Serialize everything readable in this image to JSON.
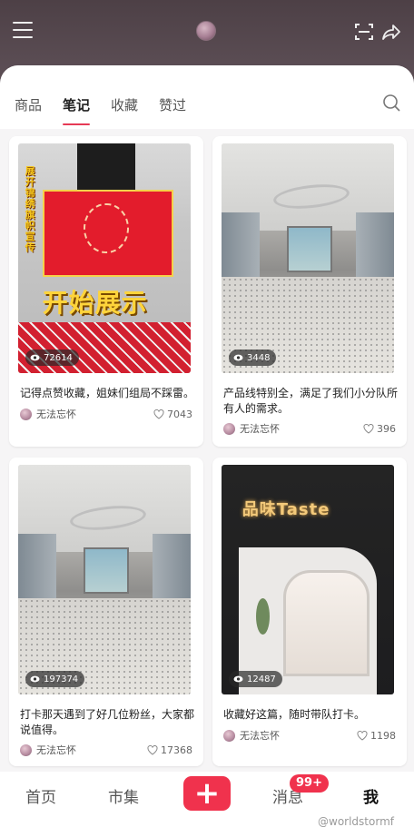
{
  "header": {
    "menu_icon": "menu-icon",
    "scan_icon": "scan-icon",
    "share_icon": "share-icon"
  },
  "tabs": [
    {
      "label": "商品"
    },
    {
      "label": "笔记",
      "active": true
    },
    {
      "label": "收藏"
    },
    {
      "label": "赞过"
    }
  ],
  "search_icon": "search-icon",
  "accent_color": "#e63a55",
  "posts": [
    {
      "title": "记得点赞收藏，姐妹们组局不踩雷。",
      "views": "72614",
      "author": "无法忘怀",
      "likes": "7043",
      "image_text": "开始展示",
      "side_text": "展开锦绣旗帜宣传"
    },
    {
      "title": "产品线特别全，满足了我们小分队所有人的需求。",
      "views": "3448",
      "author": "无法忘怀",
      "likes": "396"
    },
    {
      "title": "打卡那天遇到了好几位粉丝，大家都说值得。",
      "views": "197374",
      "author": "无法忘怀",
      "likes": "17368"
    },
    {
      "title": "收藏好这篇，随时带队打卡。",
      "views": "12487",
      "author": "无法忘怀",
      "likes": "1198",
      "image_text": "品味Taste"
    }
  ],
  "bottom_nav": {
    "home": "首页",
    "market": "市集",
    "plus": "+",
    "messages": "消息",
    "messages_badge": "99+",
    "me": "我"
  },
  "watermark": "@worldstormf"
}
